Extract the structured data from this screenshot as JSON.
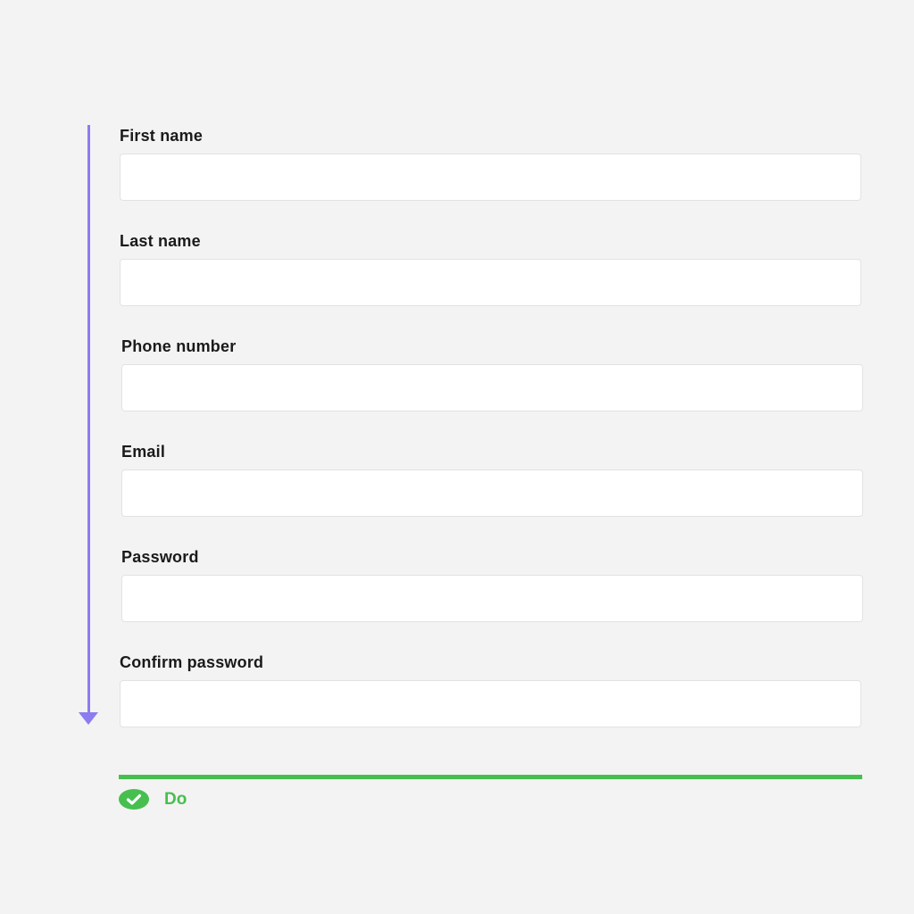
{
  "form": {
    "fields": [
      {
        "label": "First name",
        "value": ""
      },
      {
        "label": "Last name",
        "value": ""
      },
      {
        "label": "Phone number",
        "value": ""
      },
      {
        "label": "Email",
        "value": ""
      },
      {
        "label": "Password",
        "value": ""
      },
      {
        "label": "Confirm password",
        "value": ""
      }
    ]
  },
  "guideline": {
    "label": "Do",
    "icon": "check-circle-icon",
    "color": "#47bf4f"
  },
  "flow_indicator": {
    "icon": "down-arrow-icon",
    "color": "#8b7cf0"
  }
}
